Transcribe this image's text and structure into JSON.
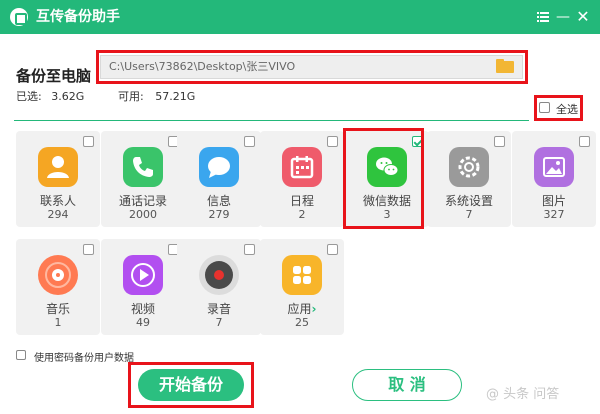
{
  "window": {
    "title": "互传备份助手",
    "menu_icon": "menu-icon",
    "minimize_glyph": "—",
    "close_glyph": "✕"
  },
  "header": {
    "section_label": "备份至电脑",
    "path_value": "C:\\Users\\73862\\Desktop\\张三VIVO",
    "folder_icon": "folder-icon",
    "used_label": "已选:",
    "used_value": "3.62G",
    "free_label": "可用:",
    "free_value": "57.21G",
    "select_all_label": "全选"
  },
  "tiles": [
    {
      "name": "联系人",
      "count": "294",
      "icon": "contacts-icon",
      "color": "#f5a623",
      "checked": false
    },
    {
      "name": "通话记录",
      "count": "2000",
      "icon": "phone-icon",
      "color": "#3ac46a",
      "checked": false
    },
    {
      "name": "信息",
      "count": "279",
      "icon": "message-icon",
      "color": "#3aa6ee",
      "checked": false
    },
    {
      "name": "日程",
      "count": "2",
      "icon": "calendar-icon",
      "color": "#ef5b6b",
      "checked": false
    },
    {
      "name": "微信数据",
      "count": "3",
      "icon": "wechat-icon",
      "color": "#2fc43e",
      "checked": true
    },
    {
      "name": "系统设置",
      "count": "7",
      "icon": "settings-icon",
      "color": "#9a9a9a",
      "checked": false
    },
    {
      "name": "图片",
      "count": "327",
      "icon": "pictures-icon",
      "color": "#b070e0",
      "checked": false
    },
    {
      "name": "音乐",
      "count": "1",
      "icon": "music-icon",
      "color": "#ff7a52",
      "checked": false
    },
    {
      "name": "视频",
      "count": "49",
      "icon": "video-icon",
      "color": "#b24ff0",
      "checked": false
    },
    {
      "name": "录音",
      "count": "7",
      "icon": "recorder-icon",
      "color": "#4a4a4a",
      "checked": false
    },
    {
      "name": "应用",
      "count": "25",
      "icon": "apps-icon",
      "color": "#f8b52a",
      "checked": false,
      "arrow": "›"
    }
  ],
  "footer": {
    "password_option_label": "使用密码备份用户数据",
    "start_button": "开始备份",
    "cancel_button": "取 消",
    "watermark": "@ 头条 问答"
  },
  "colors": {
    "brand_green": "#23b87a",
    "highlight_red": "#e8131a"
  }
}
